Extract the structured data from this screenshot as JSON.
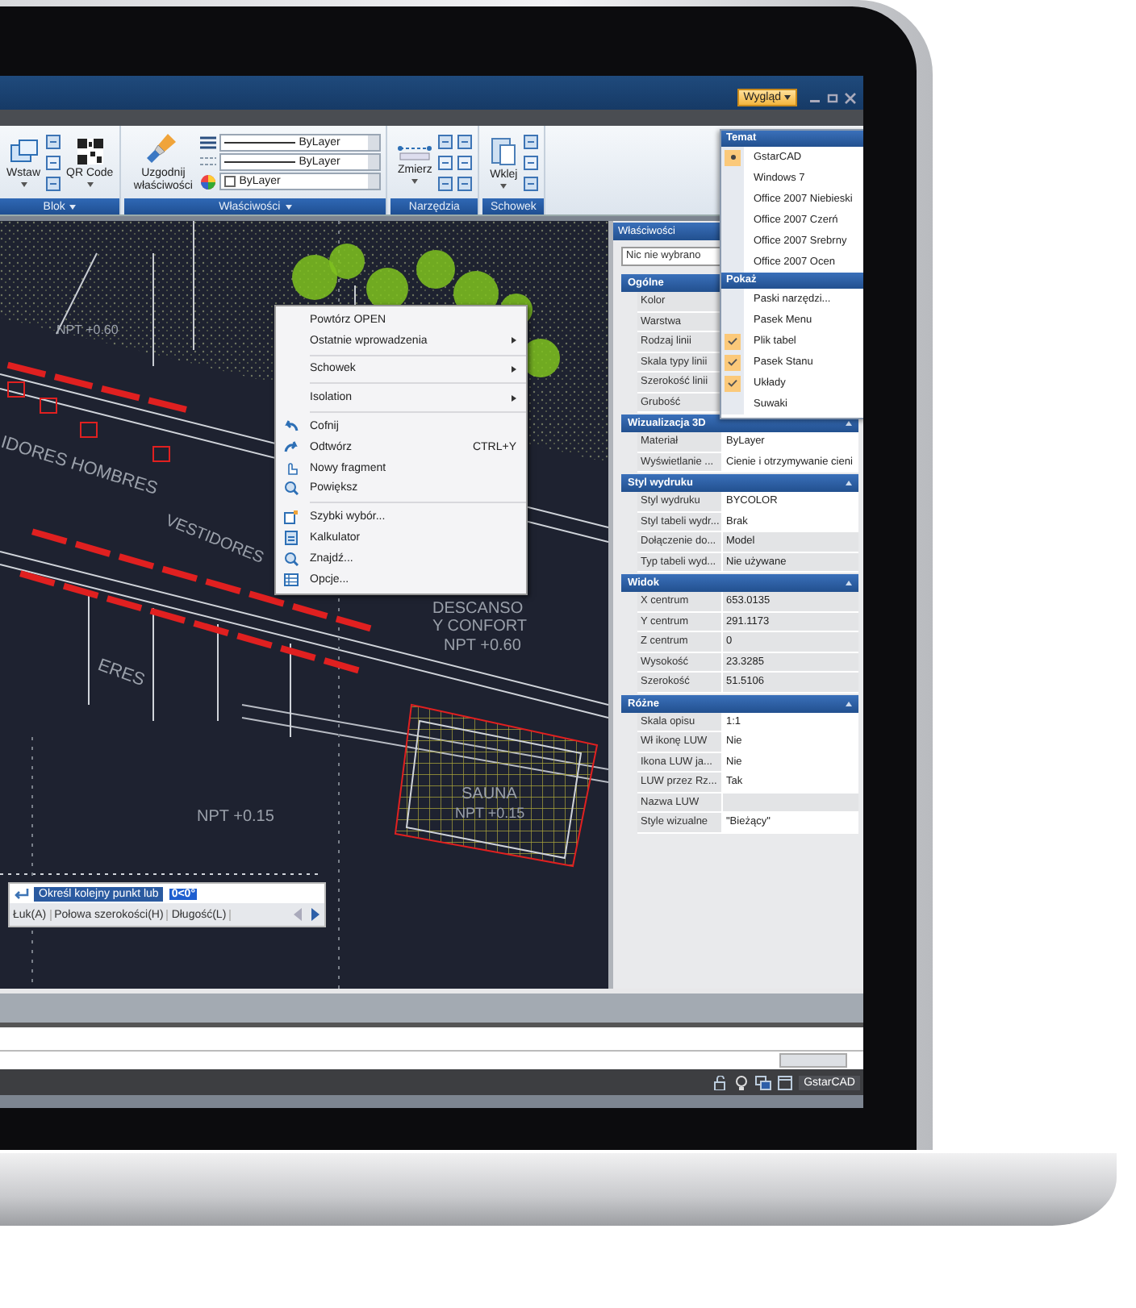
{
  "window": {
    "menu_button": "Wygląd"
  },
  "ribbon": {
    "groups": [
      {
        "label": "Blok",
        "tools": [
          "Wstaw",
          "QR Code"
        ]
      },
      {
        "label": "Właściwości",
        "tools": [
          "Uzgodnij właściwości"
        ],
        "combos": [
          "ByLayer",
          "ByLayer",
          "ByLayer"
        ]
      },
      {
        "label": "Narzędzia",
        "tools": [
          "Zmierz"
        ]
      },
      {
        "label": "Schowek",
        "tools": [
          "Wklej"
        ]
      }
    ]
  },
  "drawing_labels": [
    "NPT +0.60",
    "IDORES HOMBRES",
    "VESTIDORES",
    "ERES",
    "DESCANSO",
    "Y CONFORT",
    "NPT +0.60",
    "NPT +0.15",
    "SAUNA",
    "NPT +0.15"
  ],
  "context_menu": {
    "groups": [
      [
        {
          "label": "Powtórz OPEN",
          "submenu": false
        },
        {
          "label": "Ostatnie wprowadzenia",
          "submenu": true
        }
      ],
      [
        {
          "label": "Schowek",
          "submenu": true
        }
      ],
      [
        {
          "label": "Isolation",
          "submenu": true
        }
      ],
      [
        {
          "label": "Cofnij",
          "submenu": false
        },
        {
          "label": "Odtwórz",
          "shortcut": "CTRL+Y",
          "submenu": false
        },
        {
          "label": "Nowy fragment",
          "submenu": false
        },
        {
          "label": "Powiększ",
          "submenu": false
        }
      ],
      [
        {
          "label": "Szybki wybór...",
          "submenu": false
        },
        {
          "label": "Kalkulator",
          "submenu": false
        },
        {
          "label": "Znajdź...",
          "submenu": false
        },
        {
          "label": "Opcje...",
          "submenu": false
        }
      ]
    ]
  },
  "view_menu": {
    "sections": [
      {
        "title": "Temat",
        "kind": "radio",
        "items": [
          {
            "label": "GstarCAD",
            "selected": true
          },
          {
            "label": "Windows 7",
            "selected": false
          },
          {
            "label": "Office 2007 Niebieski",
            "selected": false
          },
          {
            "label": "Office 2007 Czerń",
            "selected": false
          },
          {
            "label": "Office 2007 Srebrny",
            "selected": false
          },
          {
            "label": "Office 2007 Ocen",
            "selected": false
          }
        ]
      },
      {
        "title": "Pokaż",
        "kind": "check",
        "items": [
          {
            "label": "Paski narzędzi...",
            "checked": false
          },
          {
            "label": "Pasek Menu",
            "checked": false
          },
          {
            "label": "Plik tabel",
            "checked": true
          },
          {
            "label": "Pasek Stanu",
            "checked": true
          },
          {
            "label": "Układy",
            "checked": true
          },
          {
            "label": "Suwaki",
            "checked": false
          }
        ]
      }
    ]
  },
  "properties": {
    "title": "Właściwości",
    "selection": "Nic nie wybrano",
    "sections": [
      {
        "title": "Ogólne",
        "rows": [
          {
            "label": "Kolor"
          },
          {
            "label": "Warstwa"
          },
          {
            "label": "Rodzaj linii"
          },
          {
            "label": "Skala typy linii"
          },
          {
            "label": "Szerokość linii"
          },
          {
            "label": "Grubość"
          }
        ]
      },
      {
        "title": "Wizualizacja 3D",
        "rows": [
          {
            "label": "Materiał",
            "value": "ByLayer",
            "editable": true
          },
          {
            "label": "Wyświetlanie ...",
            "value": "Cienie i otrzymywanie cieni",
            "editable": true
          }
        ]
      },
      {
        "title": "Styl wydruku",
        "rows": [
          {
            "label": "Styl wydruku",
            "value": "BYCOLOR",
            "editable": true
          },
          {
            "label": "Styl tabeli wydr...",
            "value": "Brak",
            "editable": true
          },
          {
            "label": "Dołączenie do...",
            "value": "Model",
            "editable": false
          },
          {
            "label": "Typ tabeli wyd...",
            "value": "Nie używane",
            "editable": false
          }
        ]
      },
      {
        "title": "Widok",
        "rows": [
          {
            "label": "X centrum",
            "value": "653.0135",
            "editable": false
          },
          {
            "label": "Y centrum",
            "value": "291.1173",
            "editable": false
          },
          {
            "label": "Z centrum",
            "value": "0",
            "editable": false
          },
          {
            "label": "Wysokość",
            "value": "23.3285",
            "editable": false
          },
          {
            "label": "Szerokość",
            "value": "51.5106",
            "editable": false
          }
        ]
      },
      {
        "title": "Różne",
        "rows": [
          {
            "label": "Skala opisu",
            "value": "1:1",
            "editable": true
          },
          {
            "label": "Wł ikonę LUW",
            "value": "Nie",
            "editable": true
          },
          {
            "label": "Ikona LUW ja...",
            "value": "Nie",
            "editable": true
          },
          {
            "label": "LUW przez Rz...",
            "value": "Tak",
            "editable": true
          },
          {
            "label": "Nazwa LUW",
            "editable": false
          },
          {
            "label": "Style wizualne",
            "value": "\"Bieżący\"",
            "editable": true
          }
        ]
      }
    ]
  },
  "command": {
    "prompt": "Określ kolejny punkt lub",
    "value": "0<0°",
    "options": [
      "Łuk(A)",
      "Połowa szerokości(H)",
      "Długość(L)"
    ]
  },
  "status_bar": {
    "app_name": "GstarCAD"
  }
}
